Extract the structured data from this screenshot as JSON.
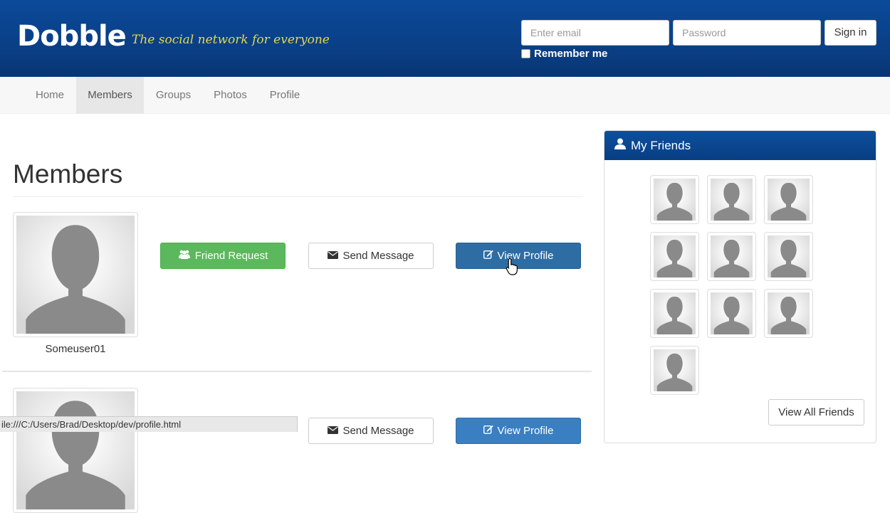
{
  "header": {
    "logo": "Dobble",
    "tagline": "The social network for everyone",
    "email_placeholder": "Enter email",
    "password_placeholder": "Password",
    "signin_label": "Sign in",
    "remember_label": "Remember me"
  },
  "nav": {
    "items": [
      {
        "label": "Home",
        "active": false
      },
      {
        "label": "Members",
        "active": true
      },
      {
        "label": "Groups",
        "active": false
      },
      {
        "label": "Photos",
        "active": false
      },
      {
        "label": "Profile",
        "active": false
      }
    ]
  },
  "main": {
    "title": "Members",
    "members": [
      {
        "username": "Someuser01",
        "friend_request_label": "Friend Request",
        "send_message_label": "Send Message",
        "view_profile_label": "View Profile"
      },
      {
        "send_message_label": "Send Message",
        "view_profile_label": "View Profile"
      }
    ]
  },
  "sidebar": {
    "title": "My Friends",
    "friend_count": 10,
    "view_all_label": "View All Friends"
  },
  "status_bar": {
    "url": "ile:///C:/Users/Brad/Desktop/dev/profile.html"
  },
  "colors": {
    "header_blue": "#0a3f86",
    "tagline_yellow": "#e8d64a",
    "success_green": "#5cb85c",
    "primary_blue": "#2e6da4"
  }
}
